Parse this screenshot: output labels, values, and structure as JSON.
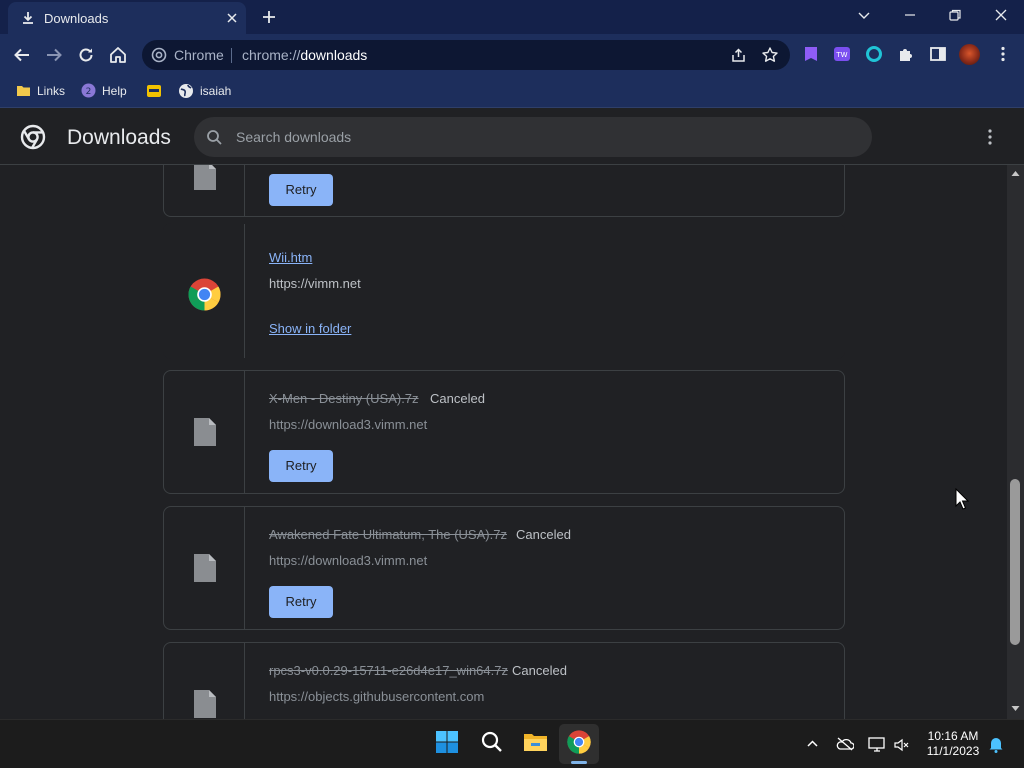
{
  "tab": {
    "title": "Downloads"
  },
  "omnibox": {
    "site_chip": "Chrome",
    "url_scheme": "chrome://",
    "url_host": "downloads"
  },
  "bookmarks": [
    {
      "label": "Links",
      "icon": "folder-icon"
    },
    {
      "label": "Help",
      "icon": "help-circle-icon"
    },
    {
      "label": "",
      "icon": "app-icon"
    },
    {
      "label": "isaiah",
      "icon": "globe-icon"
    }
  ],
  "page": {
    "title": "Downloads",
    "search_placeholder": "Search downloads"
  },
  "downloads": [
    {
      "filename": "",
      "status": "",
      "url": "",
      "action": "Retry"
    },
    {
      "filename": "Wii.htm",
      "url": "https://vimm.net",
      "action": "Show in folder"
    },
    {
      "filename": "X-Men - Destiny (USA).7z",
      "status": "Canceled",
      "url": "https://download3.vimm.net",
      "action": "Retry"
    },
    {
      "filename": "Awakened Fate Ultimatum, The (USA).7z",
      "status": "Canceled",
      "url": "https://download3.vimm.net",
      "action": "Retry"
    },
    {
      "filename": "rpcs3-v0.0.29-15711-e26d4e17_win64.7z",
      "status": "Canceled",
      "url": "https://objects.githubusercontent.com",
      "action": ""
    }
  ],
  "taskbar": {
    "time": "10:16 AM",
    "date": "11/1/2023"
  },
  "colors": {
    "titlebar": "#14214a",
    "toolbar": "#1d2e5c",
    "page_bg": "#202124",
    "link": "#8ab4f8",
    "taskbar": "#1c1c1c"
  }
}
